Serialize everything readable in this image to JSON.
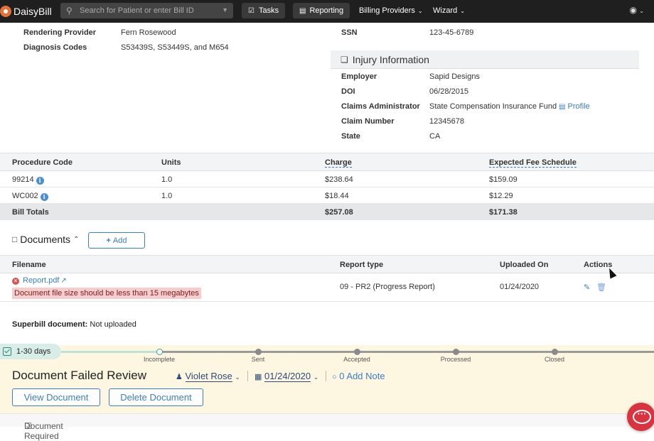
{
  "app": {
    "brand": "DaisyBill"
  },
  "navbar": {
    "search_placeholder": "Search for Patient or enter Bill ID",
    "tasks_label": "Tasks",
    "reporting_label": "Reporting",
    "billing_providers_label": "Billing Providers",
    "wizard_label": "Wizard"
  },
  "bill_info": {
    "rendering_provider_label": "Rendering Provider",
    "rendering_provider_value": "Fern Rosewood",
    "diagnosis_codes_label": "Diagnosis Codes",
    "diagnosis_codes_value": "S53439S, S53449S, and M654",
    "ssn_label": "SSN",
    "ssn_value": "123-45-6789"
  },
  "injury": {
    "title": "Injury Information",
    "employer_label": "Employer",
    "employer_value": "Sapid Designs",
    "doi_label": "DOI",
    "doi_value": "06/28/2015",
    "claims_admin_label": "Claims Administrator",
    "claims_admin_value": "State Compensation Insurance Fund",
    "profile_link": "Profile",
    "claim_number_label": "Claim Number",
    "claim_number_value": "12345678",
    "state_label": "State",
    "state_value": "CA"
  },
  "procedures": {
    "headers": {
      "code": "Procedure Code",
      "units": "Units",
      "charge": "Charge",
      "expected": "Expected Fee Schedule"
    },
    "rows": [
      {
        "code": "99214",
        "units": "1.0",
        "charge": "$238.64",
        "expected": "$159.09"
      },
      {
        "code": "WC002",
        "units": "1.0",
        "charge": "$18.44",
        "expected": "$12.29"
      }
    ],
    "totals": {
      "label": "Bill Totals",
      "charge": "$257.08",
      "expected": "$171.38"
    }
  },
  "documents": {
    "title": "Documents",
    "add_label": "Add",
    "headers": {
      "filename": "Filename",
      "report_type": "Report type",
      "uploaded_on": "Uploaded On",
      "actions": "Actions"
    },
    "rows": [
      {
        "filename": "Report.pdf",
        "error": "Document file size should be less than 15 megabytes",
        "report_type": "09 - PR2 (Progress Report)",
        "uploaded_on": "01/24/2020"
      }
    ]
  },
  "superbill": {
    "label": "Superbill document:",
    "value": "Not uploaded"
  },
  "status": {
    "days_label": "1-30 days",
    "steps": [
      "Incomplete",
      "Sent",
      "Accepted",
      "Processed",
      "Closed"
    ],
    "current_step": "Incomplete",
    "title": "Document Failed Review",
    "assignee": "Violet Rose",
    "date": "01/24/2020",
    "note_link": "0 Add Note",
    "view_document_label": "View Document",
    "delete_document_label": "Delete Document",
    "requirement_label": "Document Required"
  },
  "colors": {
    "navbar": "#1f1f1f",
    "link": "#3a7ec9",
    "panel": "#fdf6e0",
    "error_bg": "#f6cccc",
    "chat": "#d9333f"
  },
  "icons": [
    "daisy-logo-icon",
    "search-icon",
    "tasks-icon",
    "reporting-icon",
    "user-icon",
    "pencil-icon",
    "trash-icon",
    "pdf-icon",
    "info-icon",
    "error-icon",
    "external-link-icon",
    "calendar-icon",
    "comment-icon",
    "chat-icon"
  ]
}
